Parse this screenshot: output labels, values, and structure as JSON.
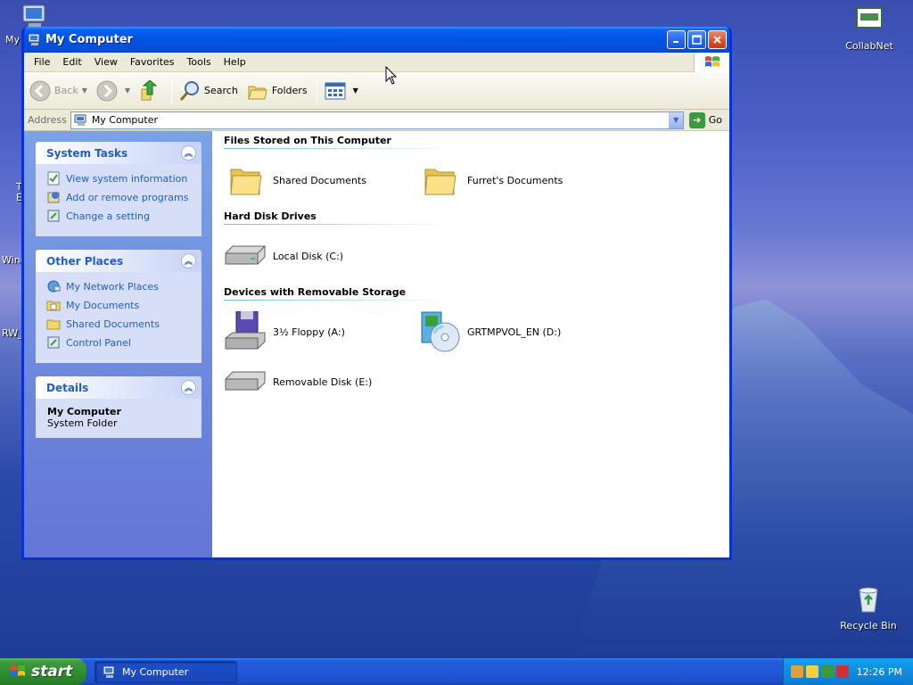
{
  "desktop": {
    "partial_labels": [
      "My",
      "T",
      "E",
      "Wind",
      "RW_"
    ],
    "icons": [
      {
        "name": "collabnet",
        "label": "CollabNet"
      },
      {
        "name": "recycle-bin",
        "label": "Recycle Bin"
      }
    ]
  },
  "window": {
    "title": "My Computer",
    "menu": [
      "File",
      "Edit",
      "View",
      "Favorites",
      "Tools",
      "Help"
    ],
    "toolbar": {
      "back_label": "Back",
      "search_label": "Search",
      "folders_label": "Folders"
    },
    "address": {
      "label": "Address",
      "value": "My Computer",
      "go_label": "Go"
    },
    "panels": {
      "system_tasks": {
        "title": "System Tasks",
        "items": [
          "View system information",
          "Add or remove programs",
          "Change a setting"
        ]
      },
      "other_places": {
        "title": "Other Places",
        "items": [
          "My Network Places",
          "My Documents",
          "Shared Documents",
          "Control Panel"
        ]
      },
      "details": {
        "title": "Details",
        "name": "My Computer",
        "type": "System Folder"
      }
    },
    "groups": [
      {
        "header": "Files Stored on This Computer",
        "items": [
          "Shared Documents",
          "Furret's Documents"
        ]
      },
      {
        "header": "Hard Disk Drives",
        "items": [
          "Local Disk (C:)"
        ]
      },
      {
        "header": "Devices with Removable Storage",
        "items": [
          "3½ Floppy (A:)",
          "GRTMPVOL_EN (D:)",
          "Removable Disk (E:)"
        ]
      }
    ]
  },
  "taskbar": {
    "start_label": "start",
    "task_label": "My Computer",
    "clock": "12:26 PM"
  },
  "colors": {
    "xp_blue": "#0054e3",
    "link_blue": "#215dc6",
    "start_green": "#3c9a3c"
  }
}
